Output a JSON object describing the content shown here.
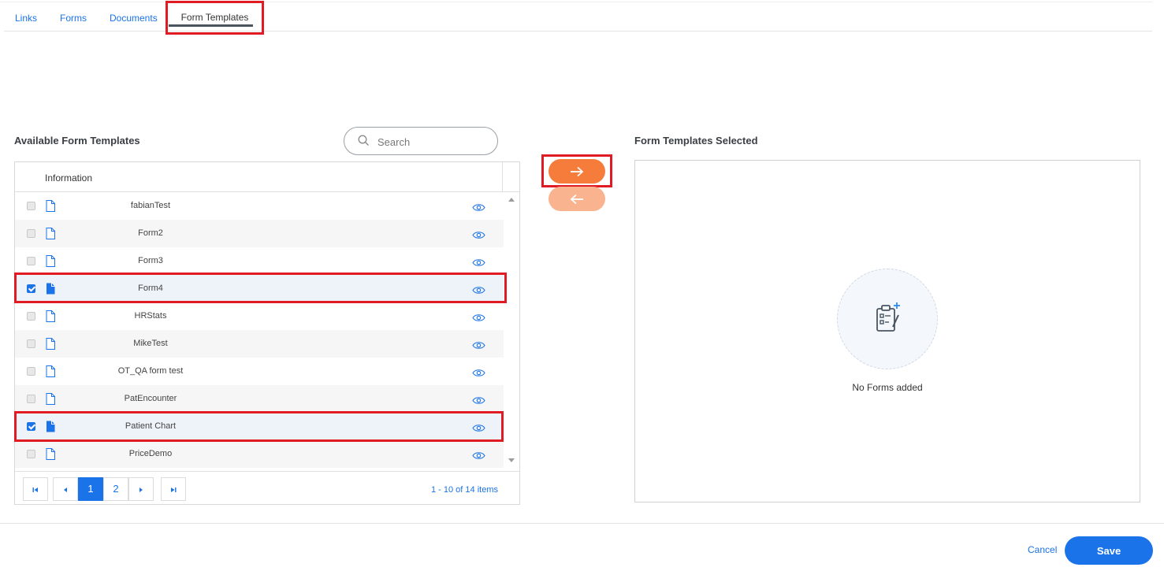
{
  "tabs": {
    "links": "Links",
    "forms": "Forms",
    "documents": "Documents",
    "form_templates": "Form Templates",
    "active": "Form Templates"
  },
  "available": {
    "title": "Available Form Templates",
    "search_placeholder": "Search",
    "column_header": "Information",
    "rows": [
      {
        "name": "fabianTest",
        "checked": false
      },
      {
        "name": "Form2",
        "checked": false
      },
      {
        "name": "Form3",
        "checked": false
      },
      {
        "name": "Form4",
        "checked": true
      },
      {
        "name": "HRStats",
        "checked": false
      },
      {
        "name": "MikeTest",
        "checked": false
      },
      {
        "name": "OT_QA form test",
        "checked": false
      },
      {
        "name": "PatEncounter",
        "checked": false
      },
      {
        "name": "Patient Chart",
        "checked": true
      },
      {
        "name": "PriceDemo",
        "checked": false
      }
    ],
    "pager": {
      "pages": [
        "1",
        "2"
      ],
      "current_page": "1",
      "info": "1 - 10 of 14 items"
    }
  },
  "transfer": {
    "move_right_icon": "arrow-right-icon",
    "move_left_icon": "arrow-left-icon"
  },
  "selected": {
    "title": "Form Templates Selected",
    "empty_icon": "clipboard-add-icon",
    "empty_text": "No Forms added"
  },
  "footer": {
    "cancel_label": "Cancel",
    "save_label": "Save"
  },
  "colors": {
    "accent": "#1a73e8",
    "move_button": "#f57c3a",
    "move_button_disabled": "#f9b38f",
    "highlight_box": "#e01b24"
  }
}
